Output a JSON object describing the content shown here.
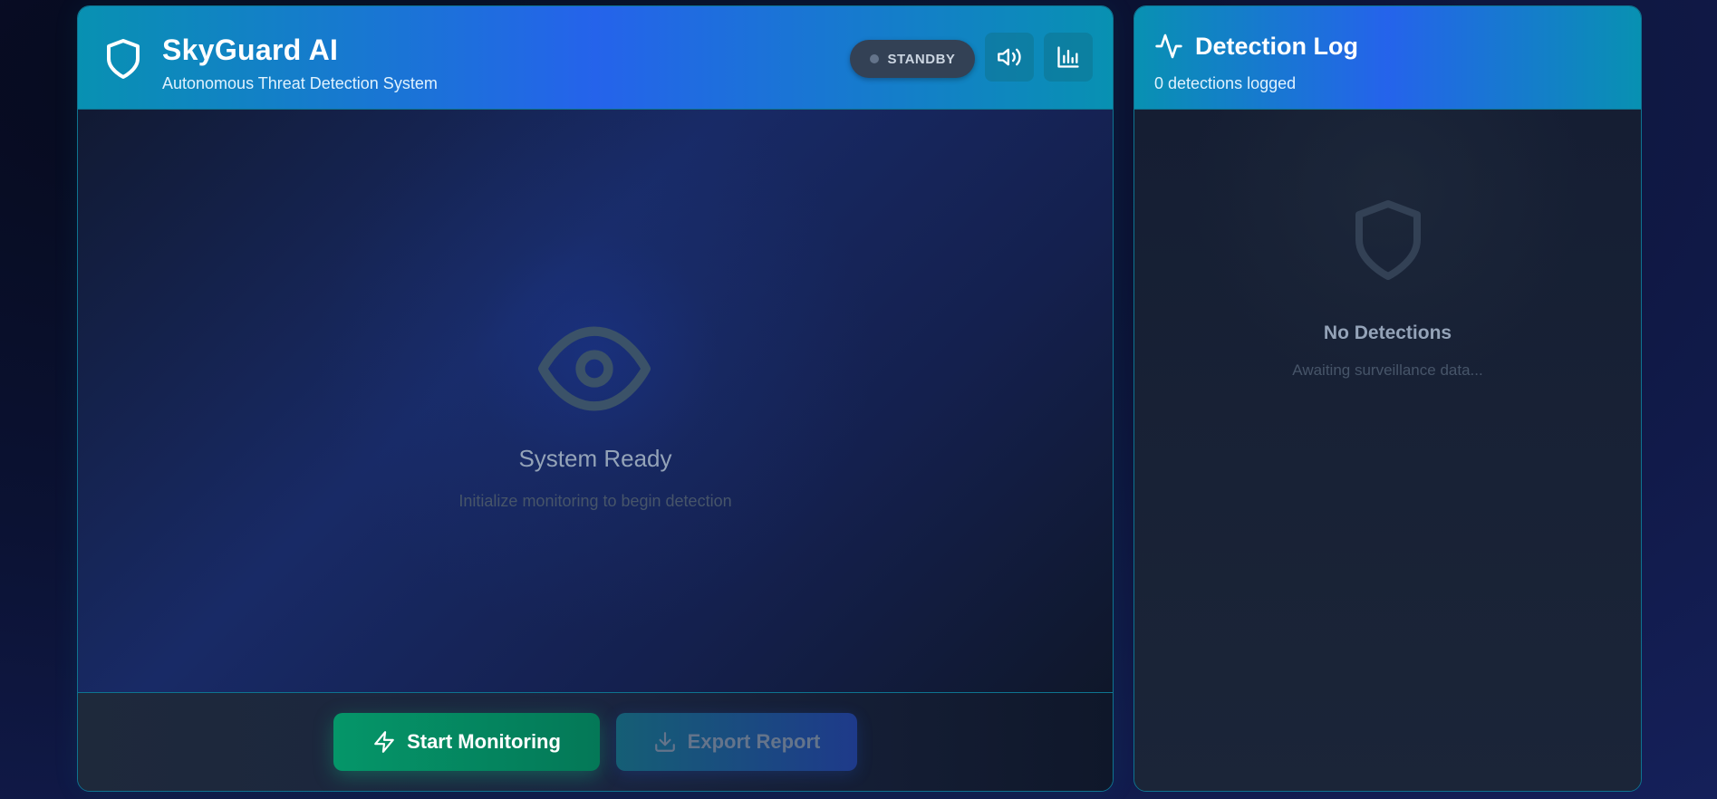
{
  "header": {
    "title": "SkyGuard AI",
    "subtitle": "Autonomous Threat Detection System",
    "status": "STANDBY",
    "icons": [
      "shield-icon",
      "volume-icon",
      "bar-chart-icon"
    ]
  },
  "viewer": {
    "icon": "eye-icon",
    "title": "System Ready",
    "subtitle": "Initialize monitoring to begin detection"
  },
  "actions": {
    "start_label": "Start Monitoring",
    "start_icon": "lightning-icon",
    "export_label": "Export Report",
    "export_icon": "download-icon"
  },
  "log": {
    "icon": "activity-icon",
    "title": "Detection Log",
    "count_text": "0 detections logged",
    "empty_icon": "shield-icon",
    "empty_title": "No Detections",
    "empty_subtitle": "Awaiting surveillance data..."
  },
  "colors": {
    "header_start": "#0891b2",
    "header_mid": "#2563eb",
    "border": "#0e7490",
    "start_button": "#059669",
    "status_pill": "#334155",
    "muted_text": "#94a3b8"
  }
}
